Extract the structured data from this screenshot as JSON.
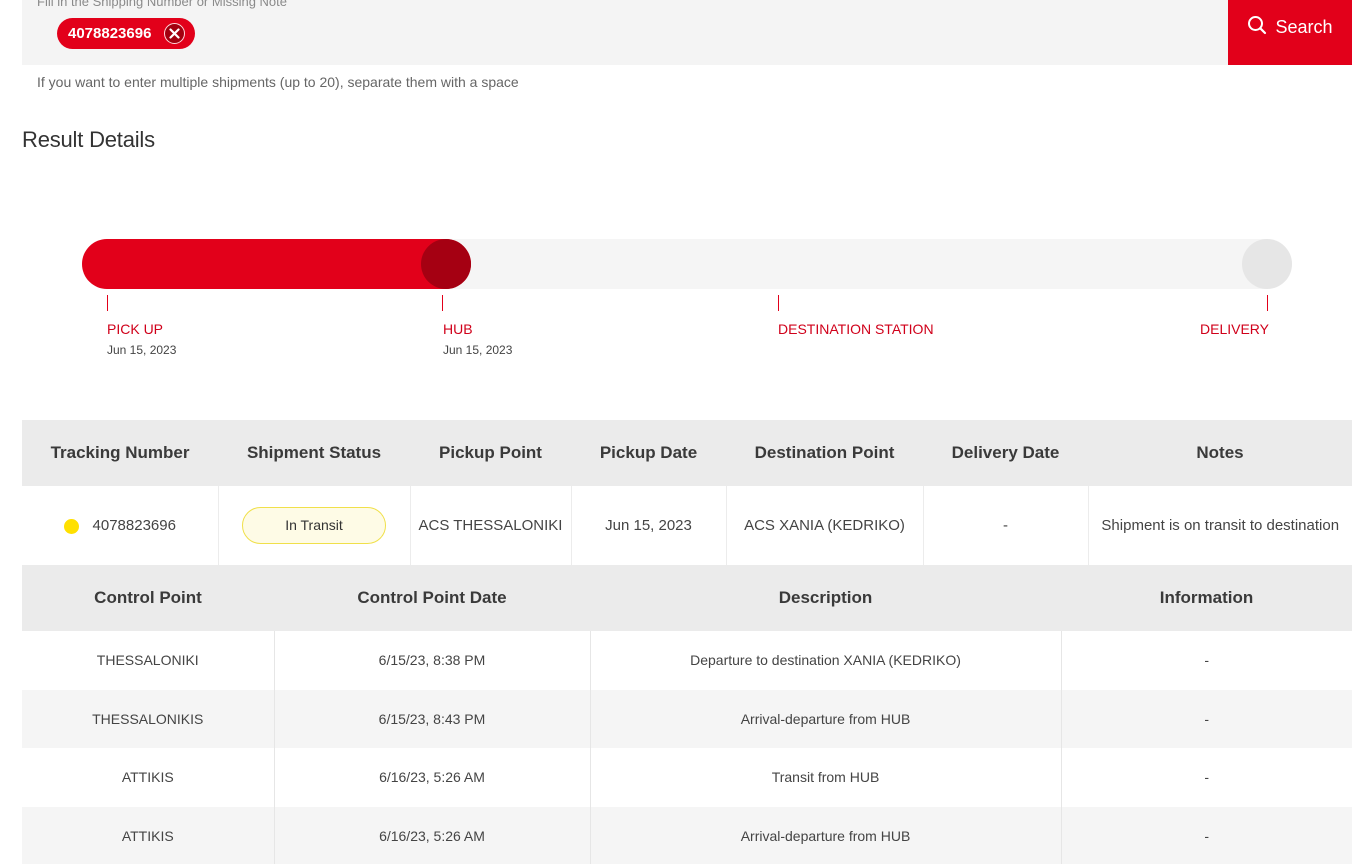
{
  "search": {
    "placeholder": "Fill in the Shipping Number or Missing Note",
    "chip_value": "4078823696",
    "button_label": "Search",
    "hint": "If you want to enter multiple shipments (up to 20), separate them with a space"
  },
  "result": {
    "title": "Result Details"
  },
  "progress": {
    "steps": [
      {
        "label": "PICK UP",
        "date": "Jun 15, 2023"
      },
      {
        "label": "HUB",
        "date": "Jun 15, 2023"
      },
      {
        "label": "DESTINATION STATION",
        "date": ""
      },
      {
        "label": "DELIVERY",
        "date": ""
      }
    ]
  },
  "summary": {
    "headers": [
      "Tracking Number",
      "Shipment Status",
      "Pickup Point",
      "Pickup Date",
      "Destination Point",
      "Delivery Date",
      "Notes"
    ],
    "row": {
      "tracking_number": "4078823696",
      "status": "In Transit",
      "pickup_point": "ACS THESSALONIKI",
      "pickup_date": "Jun 15, 2023",
      "destination_point": "ACS XANIA (KEDRIKO)",
      "delivery_date": "-",
      "notes": "Shipment is on transit to destination"
    }
  },
  "control": {
    "headers": [
      "Control Point",
      "Control Point Date",
      "Description",
      "Information"
    ],
    "rows": [
      {
        "point": "THESSALONIKI",
        "date": "6/15/23, 8:38 PM",
        "description": "Departure to destination XANIA (KEDRIKO)",
        "info": "-"
      },
      {
        "point": "THESSALONIKIS",
        "date": "6/15/23, 8:43 PM",
        "description": "Arrival-departure from HUB",
        "info": "-"
      },
      {
        "point": "ATTIKIS",
        "date": "6/16/23, 5:26 AM",
        "description": "Transit from HUB",
        "info": "-"
      },
      {
        "point": "ATTIKIS",
        "date": "6/16/23, 5:26 AM",
        "description": "Arrival-departure from HUB",
        "info": "-"
      }
    ]
  },
  "colors": {
    "brand_red": "#e2001a",
    "dark_red": "#a50012",
    "status_yellow": "#ffe000"
  }
}
